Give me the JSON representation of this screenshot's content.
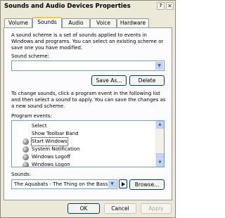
{
  "window": {
    "title": "Sounds and Audio Devices Properties",
    "help_glyph": "?",
    "close_glyph": "✕"
  },
  "tabs": [
    {
      "label": "Volume",
      "active": false
    },
    {
      "label": "Sounds",
      "active": true
    },
    {
      "label": "Audio",
      "active": false
    },
    {
      "label": "Voice",
      "active": false
    },
    {
      "label": "Hardware",
      "active": false
    }
  ],
  "sounds_panel": {
    "intro_text": "A sound scheme is a set of sounds applied to events in Windows and programs. You can select an existing scheme or save one you have modified.",
    "scheme_label": "Sound scheme:",
    "scheme_value": "",
    "save_as_label": "Save As...",
    "delete_label": "Delete",
    "instructions_text": "To change sounds, click a program event in the following list and then select a sound to apply. You can save the changes as a new sound scheme.",
    "program_events_label": "Program events:",
    "events": [
      {
        "label": "Select",
        "has_sound": false
      },
      {
        "label": "Show Toolbar Band",
        "has_sound": false
      },
      {
        "label": "Start Windows",
        "has_sound": true,
        "focused": true
      },
      {
        "label": "System Notification",
        "has_sound": true
      },
      {
        "label": "Windows Logoff",
        "has_sound": true
      },
      {
        "label": "Windows Logon",
        "has_sound": true
      }
    ],
    "sounds_label": "Sounds:",
    "sound_value": "The Aquabats - The Thing on the Bass",
    "browse_label": "Browse..."
  },
  "footer": {
    "ok_label": "OK",
    "cancel_label": "Cancel",
    "apply_label": "Apply"
  },
  "icons": {
    "dropdown": "chevron-down-icon",
    "scroll_up": "chevron-up-icon",
    "play": "play-icon",
    "event_sound": "speaker-icon"
  },
  "colors": {
    "face": "#ece9d8",
    "panel": "#fcfcfe",
    "active_tab_accent": "#ffc83c",
    "button_border": "#003c74",
    "field_border": "#7f9db9"
  }
}
